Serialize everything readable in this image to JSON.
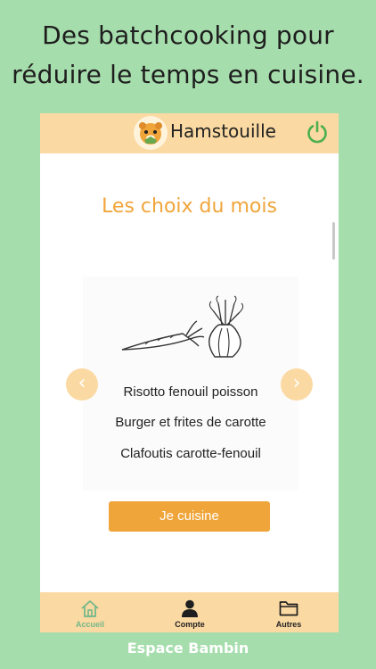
{
  "headline": {
    "line1": "Des batchcooking pour",
    "line2": "réduire le temps en cuisine."
  },
  "app": {
    "title": "Hamstouille",
    "logo_icon": "hamster-logo-icon",
    "power_icon": "power-icon"
  },
  "main": {
    "section_title": "Les choix du mois",
    "illustration_icon": "carrot-fennel-icon",
    "recipes": [
      "Risotto fenouil poisson",
      "Burger et frites de carotte",
      "Clafoutis carotte-fenouil"
    ],
    "prev_label": "‹",
    "next_label": "›",
    "cta_label": "Je cuisine"
  },
  "tabs": [
    {
      "label": "Accueil",
      "icon": "home-icon",
      "active": true
    },
    {
      "label": "Compte",
      "icon": "user-icon",
      "active": false
    },
    {
      "label": "Autres",
      "icon": "folder-icon",
      "active": false
    }
  ],
  "footer": {
    "label": "Espace Bambin"
  },
  "colors": {
    "background": "#a6ddac",
    "header": "#fbd9a2",
    "accent": "#f0a53a",
    "active_tab": "#72b88a",
    "power": "#4caf50"
  }
}
